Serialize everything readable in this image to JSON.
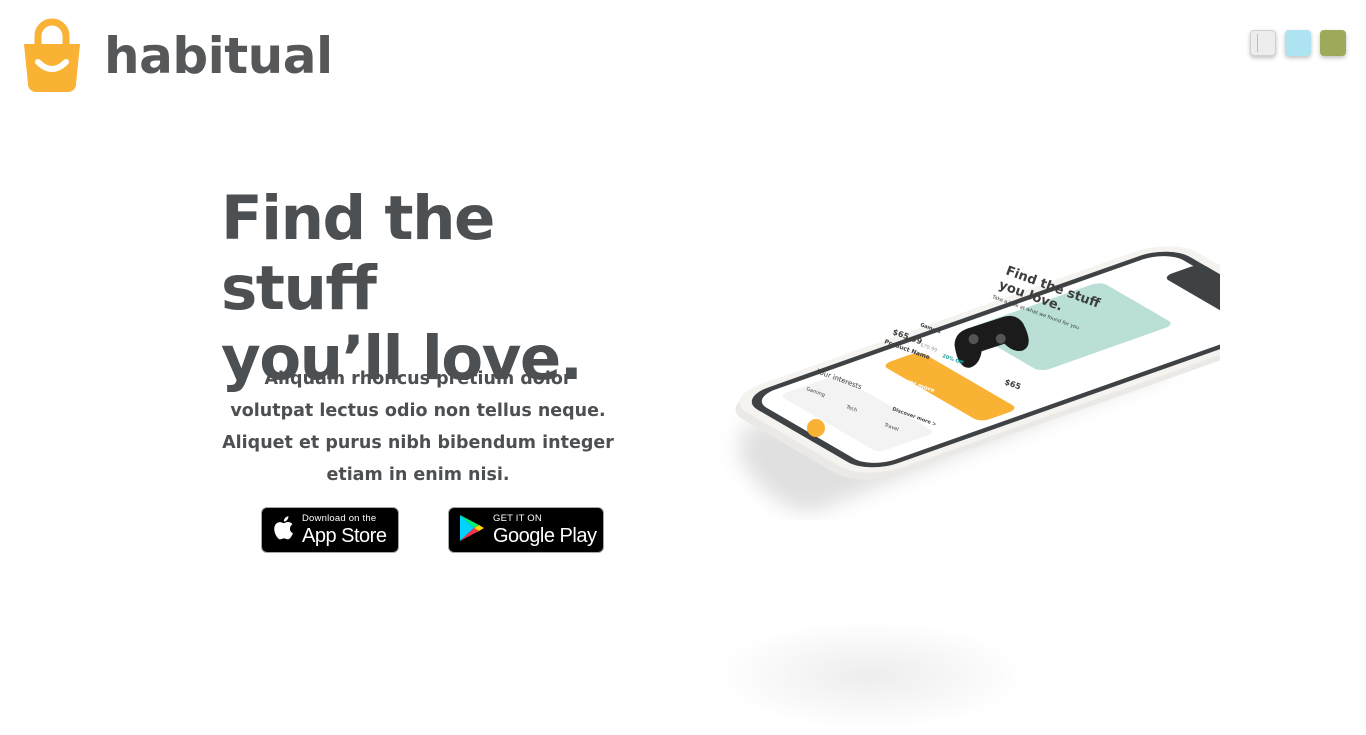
{
  "brand": {
    "name": "habitual",
    "icon": "shopping-bag-smile-icon",
    "color": "#f9b233"
  },
  "theme_swatches": [
    {
      "name": "light-theme",
      "color": "#ededed"
    },
    {
      "name": "blue-theme",
      "color": "#aee3f2"
    },
    {
      "name": "olive-theme",
      "color": "#9fa95a"
    }
  ],
  "hero": {
    "headline_line1": "Find the stuff",
    "headline_line2": "you’ll love.",
    "description": "Aliquam rhoncus pretium dolor volutpat lectus odio non tellus neque. Aliquet et purus nibh bibendum integer etiam in enim nisi."
  },
  "badges": {
    "app_store": {
      "small": "Download on the",
      "big": "App Store",
      "icon": "apple-icon"
    },
    "google_play": {
      "small": "GET IT ON",
      "big": "Google Play",
      "icon": "google-play-icon"
    }
  },
  "phone_screen": {
    "title_line1": "Find the stuff",
    "title_line2": "you love.",
    "subtitle": "Take a look at what we found for you",
    "tag": "Gamers",
    "price": "$65.99",
    "old_price": "$79.99",
    "discount": "20% Off",
    "product_name": "Product Name",
    "cta": "Discover more",
    "section_title": "Your interests",
    "interests": [
      "Gaming",
      "Tech",
      "Travel"
    ],
    "discover_more": "Discover more >",
    "second_price": "$65"
  }
}
